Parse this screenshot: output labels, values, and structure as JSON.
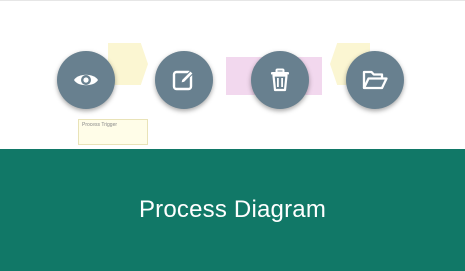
{
  "card": {
    "title": "Process Diagram"
  },
  "thumbnail": {
    "note_text": "Process Trigger"
  },
  "actions": [
    {
      "name": "view",
      "icon": "eye-icon"
    },
    {
      "name": "edit",
      "icon": "edit-icon"
    },
    {
      "name": "delete",
      "icon": "trash-icon"
    },
    {
      "name": "open",
      "icon": "folder-open-icon"
    }
  ],
  "colors": {
    "footer": "#117867",
    "action_button": "#68808f",
    "title_text": "#ffffff"
  }
}
